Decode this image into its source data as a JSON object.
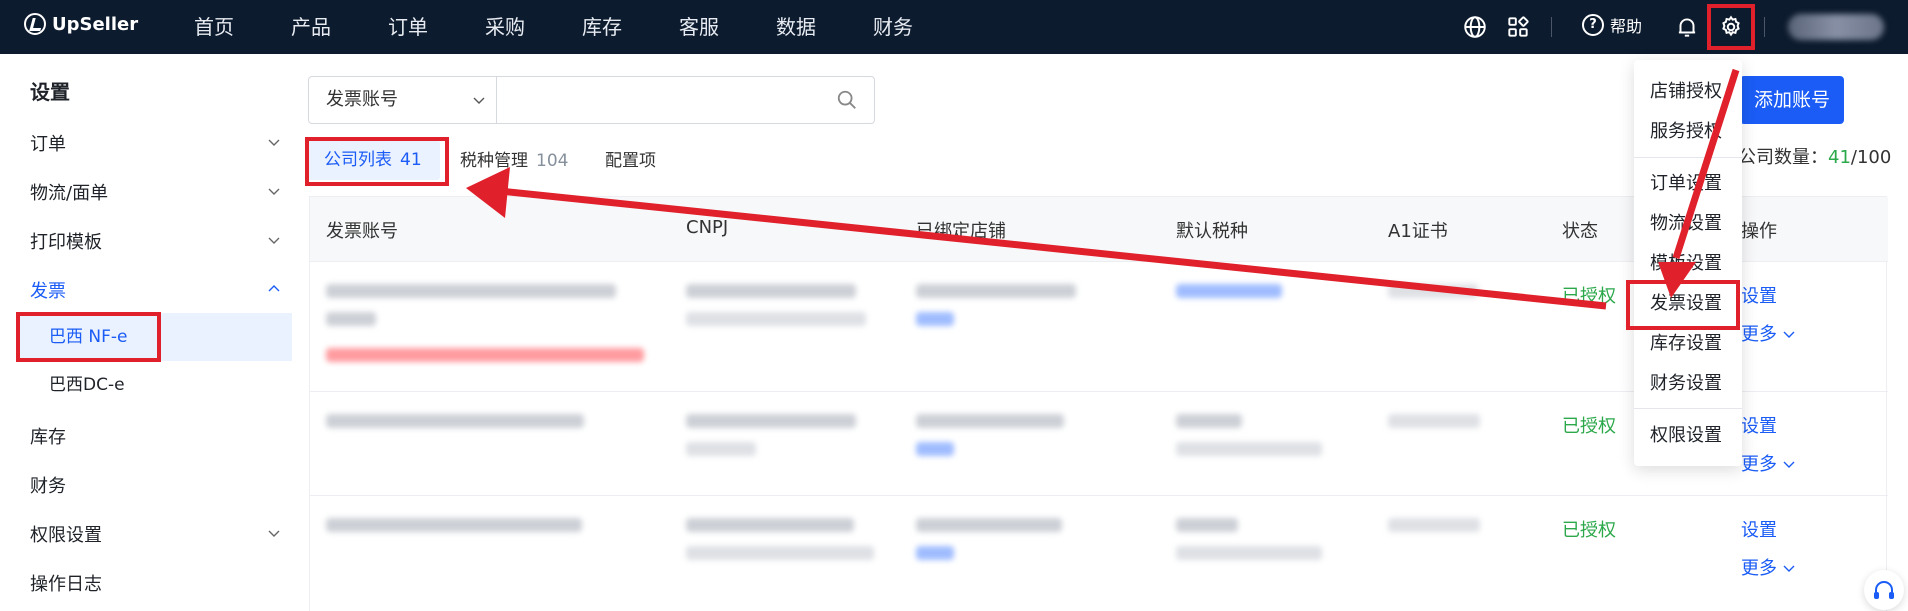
{
  "brand": {
    "name": "UpSeller"
  },
  "nav": [
    "首页",
    "产品",
    "订单",
    "采购",
    "库存",
    "客服",
    "数据",
    "财务"
  ],
  "topbar": {
    "help_label": "帮助"
  },
  "sidebar": {
    "title": "设置",
    "items": [
      {
        "label": "订单",
        "expanded": false
      },
      {
        "label": "物流/面单",
        "expanded": false
      },
      {
        "label": "打印模板",
        "expanded": false
      },
      {
        "label": "发票",
        "expanded": true
      },
      {
        "label": "库存"
      },
      {
        "label": "财务"
      },
      {
        "label": "权限设置",
        "expanded": false
      },
      {
        "label": "操作日志"
      }
    ],
    "sub_items": [
      "巴西 NF-e",
      "巴西DC-e"
    ]
  },
  "search": {
    "select_value": "发票账号",
    "placeholder": ""
  },
  "add_button": "添加账号",
  "tabs": [
    {
      "label": "公司列表",
      "count": "41"
    },
    {
      "label": "税种管理",
      "count": "104"
    },
    {
      "label": "配置项",
      "count": ""
    }
  ],
  "company_count": {
    "label": "公司数量：",
    "current": "41",
    "total": "/100"
  },
  "table": {
    "headers": [
      "发票账号",
      "CNPJ",
      "已绑定店铺",
      "默认税种",
      "A1证书",
      "状态",
      "操作"
    ],
    "rows": [
      {
        "status": "已授权",
        "op1": "设置",
        "op2": "更多"
      },
      {
        "status": "已授权",
        "op1": "设置",
        "op2": "更多"
      },
      {
        "status": "已授权",
        "op1": "设置",
        "op2": "更多"
      }
    ]
  },
  "settings_menu": {
    "items": [
      "店铺授权",
      "服务授权",
      "订单设置",
      "物流设置",
      "模板设置",
      "发票设置",
      "库存设置",
      "财务设置",
      "权限设置"
    ]
  },
  "colors": {
    "accent": "#1a5cf5",
    "topbar": "#0d1b2e",
    "success": "#2ba84a",
    "annotation": "#e0202a"
  }
}
